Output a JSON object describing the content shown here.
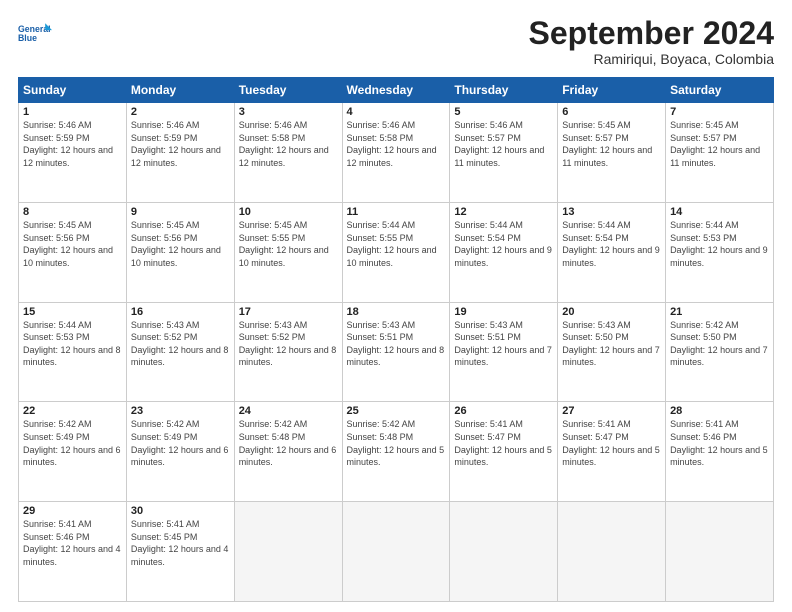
{
  "header": {
    "logo_line1": "General",
    "logo_line2": "Blue",
    "month": "September 2024",
    "location": "Ramiriqui, Boyaca, Colombia"
  },
  "weekdays": [
    "Sunday",
    "Monday",
    "Tuesday",
    "Wednesday",
    "Thursday",
    "Friday",
    "Saturday"
  ],
  "weeks": [
    [
      {
        "day": "1",
        "info": "Sunrise: 5:46 AM\nSunset: 5:59 PM\nDaylight: 12 hours and 12 minutes."
      },
      {
        "day": "2",
        "info": "Sunrise: 5:46 AM\nSunset: 5:59 PM\nDaylight: 12 hours and 12 minutes."
      },
      {
        "day": "3",
        "info": "Sunrise: 5:46 AM\nSunset: 5:58 PM\nDaylight: 12 hours and 12 minutes."
      },
      {
        "day": "4",
        "info": "Sunrise: 5:46 AM\nSunset: 5:58 PM\nDaylight: 12 hours and 12 minutes."
      },
      {
        "day": "5",
        "info": "Sunrise: 5:46 AM\nSunset: 5:57 PM\nDaylight: 12 hours and 11 minutes."
      },
      {
        "day": "6",
        "info": "Sunrise: 5:45 AM\nSunset: 5:57 PM\nDaylight: 12 hours and 11 minutes."
      },
      {
        "day": "7",
        "info": "Sunrise: 5:45 AM\nSunset: 5:57 PM\nDaylight: 12 hours and 11 minutes."
      }
    ],
    [
      {
        "day": "8",
        "info": "Sunrise: 5:45 AM\nSunset: 5:56 PM\nDaylight: 12 hours and 10 minutes."
      },
      {
        "day": "9",
        "info": "Sunrise: 5:45 AM\nSunset: 5:56 PM\nDaylight: 12 hours and 10 minutes."
      },
      {
        "day": "10",
        "info": "Sunrise: 5:45 AM\nSunset: 5:55 PM\nDaylight: 12 hours and 10 minutes."
      },
      {
        "day": "11",
        "info": "Sunrise: 5:44 AM\nSunset: 5:55 PM\nDaylight: 12 hours and 10 minutes."
      },
      {
        "day": "12",
        "info": "Sunrise: 5:44 AM\nSunset: 5:54 PM\nDaylight: 12 hours and 9 minutes."
      },
      {
        "day": "13",
        "info": "Sunrise: 5:44 AM\nSunset: 5:54 PM\nDaylight: 12 hours and 9 minutes."
      },
      {
        "day": "14",
        "info": "Sunrise: 5:44 AM\nSunset: 5:53 PM\nDaylight: 12 hours and 9 minutes."
      }
    ],
    [
      {
        "day": "15",
        "info": "Sunrise: 5:44 AM\nSunset: 5:53 PM\nDaylight: 12 hours and 8 minutes."
      },
      {
        "day": "16",
        "info": "Sunrise: 5:43 AM\nSunset: 5:52 PM\nDaylight: 12 hours and 8 minutes."
      },
      {
        "day": "17",
        "info": "Sunrise: 5:43 AM\nSunset: 5:52 PM\nDaylight: 12 hours and 8 minutes."
      },
      {
        "day": "18",
        "info": "Sunrise: 5:43 AM\nSunset: 5:51 PM\nDaylight: 12 hours and 8 minutes."
      },
      {
        "day": "19",
        "info": "Sunrise: 5:43 AM\nSunset: 5:51 PM\nDaylight: 12 hours and 7 minutes."
      },
      {
        "day": "20",
        "info": "Sunrise: 5:43 AM\nSunset: 5:50 PM\nDaylight: 12 hours and 7 minutes."
      },
      {
        "day": "21",
        "info": "Sunrise: 5:42 AM\nSunset: 5:50 PM\nDaylight: 12 hours and 7 minutes."
      }
    ],
    [
      {
        "day": "22",
        "info": "Sunrise: 5:42 AM\nSunset: 5:49 PM\nDaylight: 12 hours and 6 minutes."
      },
      {
        "day": "23",
        "info": "Sunrise: 5:42 AM\nSunset: 5:49 PM\nDaylight: 12 hours and 6 minutes."
      },
      {
        "day": "24",
        "info": "Sunrise: 5:42 AM\nSunset: 5:48 PM\nDaylight: 12 hours and 6 minutes."
      },
      {
        "day": "25",
        "info": "Sunrise: 5:42 AM\nSunset: 5:48 PM\nDaylight: 12 hours and 5 minutes."
      },
      {
        "day": "26",
        "info": "Sunrise: 5:41 AM\nSunset: 5:47 PM\nDaylight: 12 hours and 5 minutes."
      },
      {
        "day": "27",
        "info": "Sunrise: 5:41 AM\nSunset: 5:47 PM\nDaylight: 12 hours and 5 minutes."
      },
      {
        "day": "28",
        "info": "Sunrise: 5:41 AM\nSunset: 5:46 PM\nDaylight: 12 hours and 5 minutes."
      }
    ],
    [
      {
        "day": "29",
        "info": "Sunrise: 5:41 AM\nSunset: 5:46 PM\nDaylight: 12 hours and 4 minutes."
      },
      {
        "day": "30",
        "info": "Sunrise: 5:41 AM\nSunset: 5:45 PM\nDaylight: 12 hours and 4 minutes."
      },
      {
        "day": "",
        "info": ""
      },
      {
        "day": "",
        "info": ""
      },
      {
        "day": "",
        "info": ""
      },
      {
        "day": "",
        "info": ""
      },
      {
        "day": "",
        "info": ""
      }
    ]
  ]
}
